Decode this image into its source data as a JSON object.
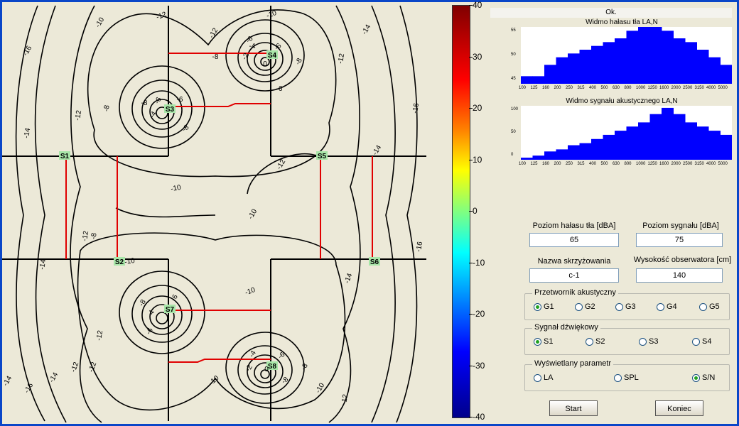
{
  "status": "Ok.",
  "colorbar": {
    "ticks": [
      "40",
      "30",
      "20",
      "10",
      "0",
      "-10",
      "-20",
      "-30",
      "-40"
    ]
  },
  "map": {
    "sensors": [
      "S1",
      "S2",
      "S3",
      "S4",
      "S5",
      "S6",
      "S7",
      "S8"
    ],
    "contour_labels": [
      "-16",
      "-14",
      "-12",
      "-10",
      "-8",
      "-6",
      "-4",
      "-2",
      "0"
    ]
  },
  "spectrum_noise": {
    "title": "Widmo hałasu tła LA,N",
    "yticks": [
      "55",
      "50",
      "45"
    ],
    "xticks": [
      "100",
      "125",
      "160",
      "200",
      "250",
      "315",
      "400",
      "500",
      "630",
      "800",
      "1000",
      "1250",
      "1600",
      "2000",
      "2500",
      "3150",
      "4000",
      "5000"
    ]
  },
  "spectrum_signal": {
    "title": "Widmo sygnału akustycznego LA,N",
    "yticks": [
      "100",
      "50",
      "0"
    ],
    "xticks": [
      "100",
      "125",
      "160",
      "200",
      "250",
      "315",
      "400",
      "500",
      "630",
      "800",
      "1000",
      "1250",
      "1600",
      "2000",
      "2500",
      "3150",
      "4000",
      "5000"
    ]
  },
  "chart_data": [
    {
      "type": "bar",
      "title": "Widmo hałasu tła LA,N",
      "categories": [
        "100",
        "125",
        "160",
        "200",
        "250",
        "315",
        "400",
        "500",
        "630",
        "800",
        "1000",
        "1250",
        "1600",
        "2000",
        "2500",
        "3150",
        "4000",
        "5000"
      ],
      "values": [
        44,
        44,
        47,
        49,
        50,
        51,
        52,
        53,
        54,
        56,
        57,
        57,
        56,
        54,
        53,
        51,
        49,
        47
      ],
      "ylim": [
        42,
        57
      ]
    },
    {
      "type": "bar",
      "title": "Widmo sygnału akustycznego LA,N",
      "categories": [
        "100",
        "125",
        "160",
        "200",
        "250",
        "315",
        "400",
        "500",
        "630",
        "800",
        "1000",
        "1250",
        "1600",
        "2000",
        "2500",
        "3150",
        "4000",
        "5000"
      ],
      "values": [
        5,
        10,
        20,
        25,
        35,
        40,
        50,
        60,
        70,
        80,
        90,
        110,
        125,
        110,
        90,
        80,
        70,
        60
      ],
      "ylim": [
        0,
        130
      ]
    }
  ],
  "fields": {
    "noise_label": "Poziom hałasu tła [dBA]",
    "noise_value": "65",
    "signal_label": "Poziom sygnału [dBA]",
    "signal_value": "75",
    "crossing_label": "Nazwa skrzyżowania",
    "crossing_value": "c-1",
    "height_label": "Wysokość obserwatora [cm]",
    "height_value": "140"
  },
  "groups": {
    "transducer": {
      "title": "Przetwornik akustyczny",
      "options": [
        "G1",
        "G2",
        "G3",
        "G4",
        "G5"
      ],
      "selected": "G1"
    },
    "signal": {
      "title": "Sygnał dźwiękowy",
      "options": [
        "S1",
        "S2",
        "S3",
        "S4"
      ],
      "selected": "S1"
    },
    "parameter": {
      "title": "Wyświetlany parametr",
      "options": [
        "LA",
        "SPL",
        "S/N"
      ],
      "selected": "S/N"
    }
  },
  "buttons": {
    "start": "Start",
    "quit": "Koniec"
  }
}
